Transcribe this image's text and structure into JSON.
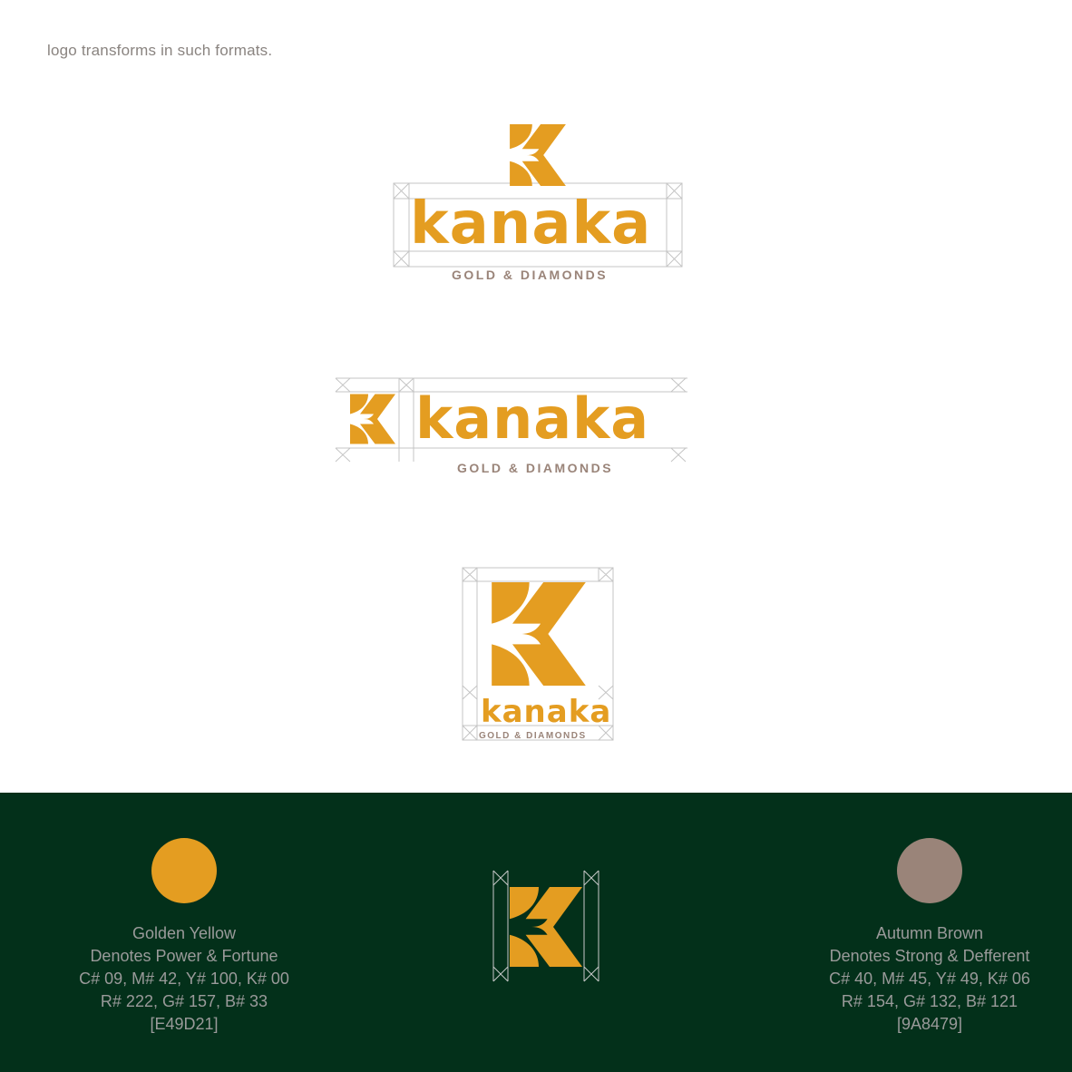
{
  "caption": "logo transforms in such formats.",
  "brand": {
    "wordmark": "kanaka",
    "tagline": "GOLD & DIAMONDS",
    "primary_color": "#E49D21",
    "secondary_color": "#9A8479",
    "guide_color": "#bdbdbd"
  },
  "background_color": "#03301a",
  "swatches": [
    {
      "name": "Golden Yellow",
      "meaning": "Denotes Power & Fortune",
      "cmyk": "C# 09, M# 42, Y# 100, K# 00",
      "rgb": "R# 222, G# 157, B# 33",
      "hex": "[E49D21]",
      "color": "#E49D21"
    },
    {
      "name": "Autumn Brown",
      "meaning": "Denotes Strong & Defferent",
      "cmyk": "C# 40, M# 45, Y# 49, K# 06",
      "rgb": "R# 154, G# 132, B# 121",
      "hex": "[9A8479]",
      "color": "#9A8479"
    }
  ]
}
